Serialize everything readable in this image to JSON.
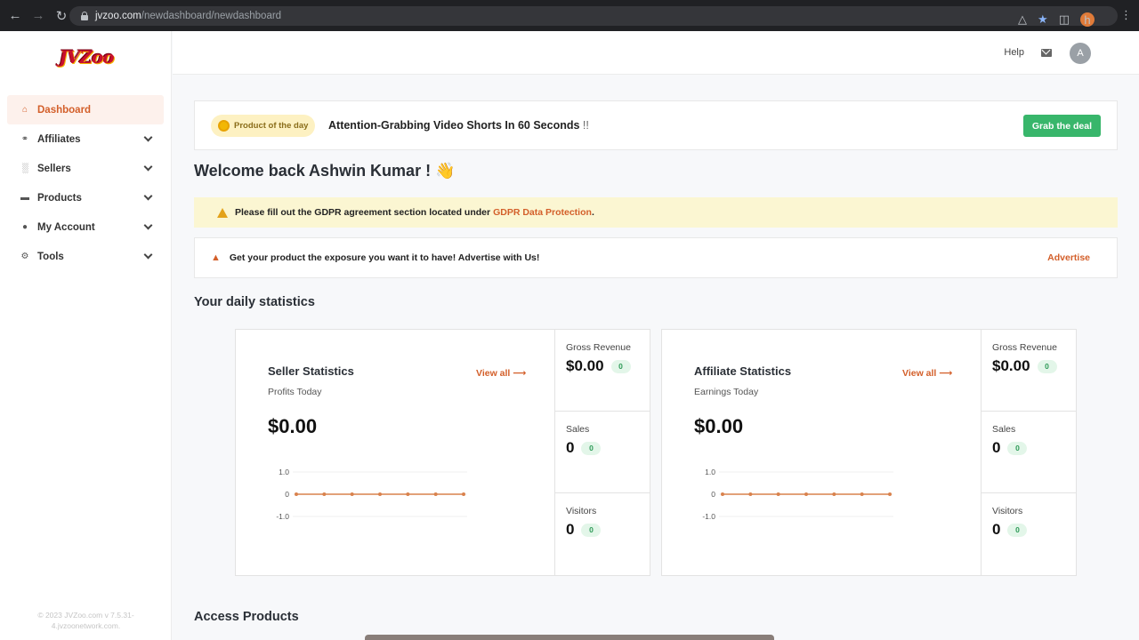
{
  "browser": {
    "url_host": "jvzoo.com",
    "url_path": "/newdashboard/newdashboard",
    "profile_initial": "h"
  },
  "sidebar": {
    "logo_text": "JVZoo",
    "items": [
      {
        "label": "Dashboard",
        "icon": "home-icon",
        "active": true
      },
      {
        "label": "Affiliates",
        "icon": "link-icon"
      },
      {
        "label": "Sellers",
        "icon": "bar-chart-icon"
      },
      {
        "label": "Products",
        "icon": "folder-icon"
      },
      {
        "label": "My Account",
        "icon": "user-icon"
      },
      {
        "label": "Tools",
        "icon": "gear-icon"
      }
    ],
    "footer": "© 2023 JVZoo.com v 7.5.31-4.jvzoonetwork.com."
  },
  "header": {
    "help_label": "Help",
    "avatar_initial": "A"
  },
  "product_of_day": {
    "badge": "Product of the day",
    "title": "Attention-Grabbing Video Shorts In 60 Seconds",
    "suffix": "!!",
    "cta": "Grab the deal"
  },
  "welcome": {
    "text": "Welcome back Ashwin Kumar !",
    "emoji": "👋"
  },
  "gdpr": {
    "text": "Please fill out the GDPR agreement section located under",
    "link": "GDPR Data Protection",
    "end": "."
  },
  "advert": {
    "text": "Get your product the exposure you want it to have! Advertise with Us!",
    "link": "Advertise"
  },
  "sections": {
    "daily_stats": "Your daily statistics",
    "access_products": "Access Products"
  },
  "seller": {
    "title": "Seller Statistics",
    "subtitle": "Profits Today",
    "view_all": "View all ⟶",
    "amount": "$0.00",
    "metrics": [
      {
        "label": "Gross Revenue",
        "value": "$0.00",
        "badge": "0"
      },
      {
        "label": "Sales",
        "value": "0",
        "badge": "0"
      },
      {
        "label": "Visitors",
        "value": "0",
        "badge": "0"
      }
    ]
  },
  "affiliate": {
    "title": "Affiliate Statistics",
    "subtitle": "Earnings Today",
    "view_all": "View all ⟶",
    "amount": "$0.00",
    "metrics": [
      {
        "label": "Gross Revenue",
        "value": "$0.00",
        "badge": "0"
      },
      {
        "label": "Sales",
        "value": "0",
        "badge": "0"
      },
      {
        "label": "Visitors",
        "value": "0",
        "badge": "0"
      }
    ]
  },
  "chart_data": [
    {
      "type": "line",
      "ytick_labels": [
        "1.0",
        "0",
        "-1.0"
      ],
      "ylim": [
        -1,
        1
      ],
      "x": [
        0,
        1,
        2,
        3,
        4,
        5,
        6
      ],
      "values": [
        0,
        0,
        0,
        0,
        0,
        0,
        0
      ],
      "color": "#d9824d"
    },
    {
      "type": "line",
      "ytick_labels": [
        "1.0",
        "0",
        "-1.0"
      ],
      "ylim": [
        -1,
        1
      ],
      "x": [
        0,
        1,
        2,
        3,
        4,
        5,
        6
      ],
      "values": [
        0,
        0,
        0,
        0,
        0,
        0,
        0
      ],
      "color": "#d9824d"
    }
  ]
}
